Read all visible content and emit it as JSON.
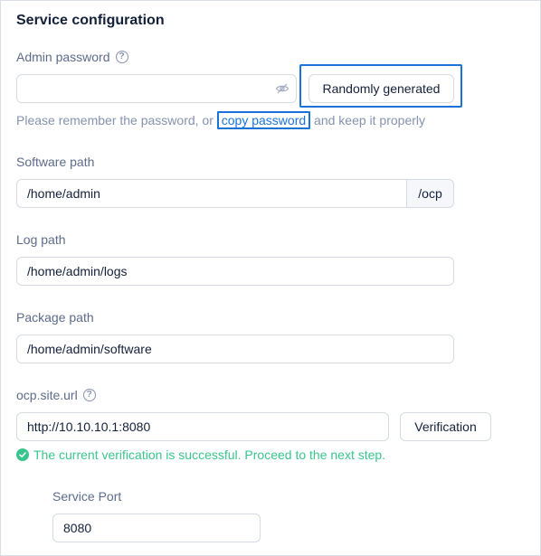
{
  "section": {
    "title": "Service configuration"
  },
  "admin_password": {
    "label": "Admin password",
    "value": "",
    "placeholder": "",
    "generate_label": "Randomly generated",
    "hint_before": "Please remember the password, or ",
    "hint_link": "copy password",
    "hint_after": " and keep it properly"
  },
  "software_path": {
    "label": "Software path",
    "value": "/home/admin",
    "suffix": "/ocp"
  },
  "log_path": {
    "label": "Log path",
    "value": "/home/admin/logs"
  },
  "package_path": {
    "label": "Package path",
    "value": "/home/admin/software"
  },
  "site_url": {
    "label": "ocp.site.url",
    "value": "http://10.10.10.1:8080",
    "verify_label": "Verification",
    "success_message": "The current verification is successful. Proceed to the next step."
  },
  "service_port": {
    "label": "Service Port",
    "value": "8080"
  },
  "icons": {
    "help": "question-circle-icon",
    "eye": "eye-invisible-icon",
    "success": "check-circle-icon"
  },
  "colors": {
    "link": "#1a73d9",
    "success": "#3ac48e",
    "highlight": "#1a73d9"
  }
}
